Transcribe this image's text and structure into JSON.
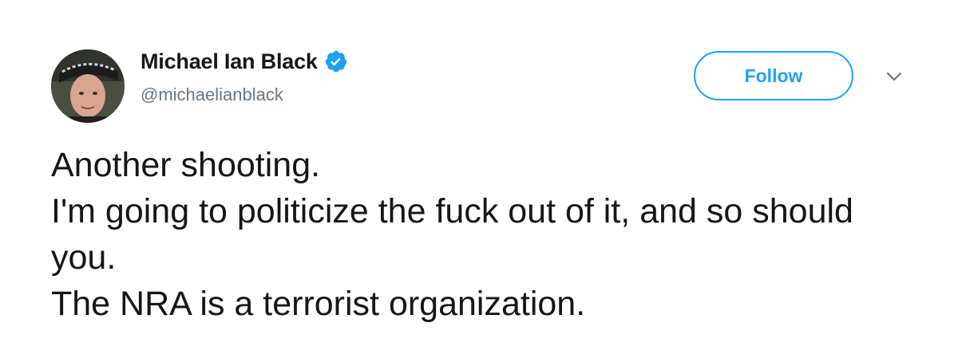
{
  "author": {
    "display_name": "Michael Ian Black",
    "handle": "@michaelianblack",
    "verified": true,
    "avatar_icon": "profile-photo"
  },
  "actions": {
    "follow_label": "Follow",
    "menu_icon": "chevron-down-icon"
  },
  "tweet": {
    "lines": [
      "Another shooting.",
      "I'm going to politicize the fuck out of it, and so should you.",
      "The NRA is a terrorist organization."
    ]
  },
  "colors": {
    "accent": "#1da1f2",
    "text": "#14171a",
    "secondary_text": "#657786",
    "caret": "#657786"
  }
}
